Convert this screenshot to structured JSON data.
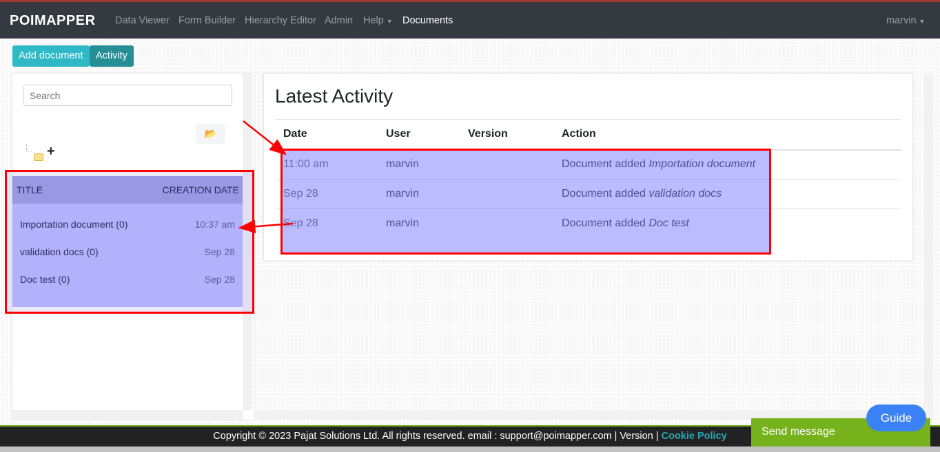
{
  "nav": {
    "logo": "POIMAPPER",
    "links": [
      "Data Viewer",
      "Form Builder",
      "Hierarchy Editor",
      "Admin",
      "Help",
      "Documents"
    ],
    "user": "marvin"
  },
  "toolbar": {
    "add_document": "Add document",
    "activity": "Activity"
  },
  "sidebar": {
    "search_placeholder": "Search",
    "headers": {
      "title": "TITLE",
      "date": "CREATION DATE"
    },
    "documents": [
      {
        "title": "Importation document (0)",
        "date": "10:37 am"
      },
      {
        "title": "validation docs (0)",
        "date": "Sep 28"
      },
      {
        "title": "Doc test (0)",
        "date": "Sep 28"
      }
    ]
  },
  "activity": {
    "title": "Latest Activity",
    "columns": [
      "Date",
      "User",
      "Version",
      "Action"
    ],
    "rows": [
      {
        "date": "11:00 am",
        "user": "marvin",
        "version": "",
        "action": "Document added ",
        "doc": "Importation document"
      },
      {
        "date": "Sep 28",
        "user": "marvin",
        "version": "",
        "action": "Document added ",
        "doc": "validation docs"
      },
      {
        "date": "Sep 28",
        "user": "marvin",
        "version": "",
        "action": "Document added ",
        "doc": "Doc test"
      }
    ]
  },
  "footer": {
    "text": "Copyright © 2023 Pajat Solutions Ltd. All rights reserved. email : support@poimapper.com | Version | ",
    "cookie": "Cookie Policy"
  },
  "widgets": {
    "send_message": "Send message",
    "guide": "Guide"
  },
  "colors": {
    "nav": "#343a40",
    "accent": "#2fb8c6",
    "activity_btn": "#268f96",
    "footer_accent": "#76b21b",
    "guide": "#3b82f6",
    "annotation": "#ff0000"
  }
}
